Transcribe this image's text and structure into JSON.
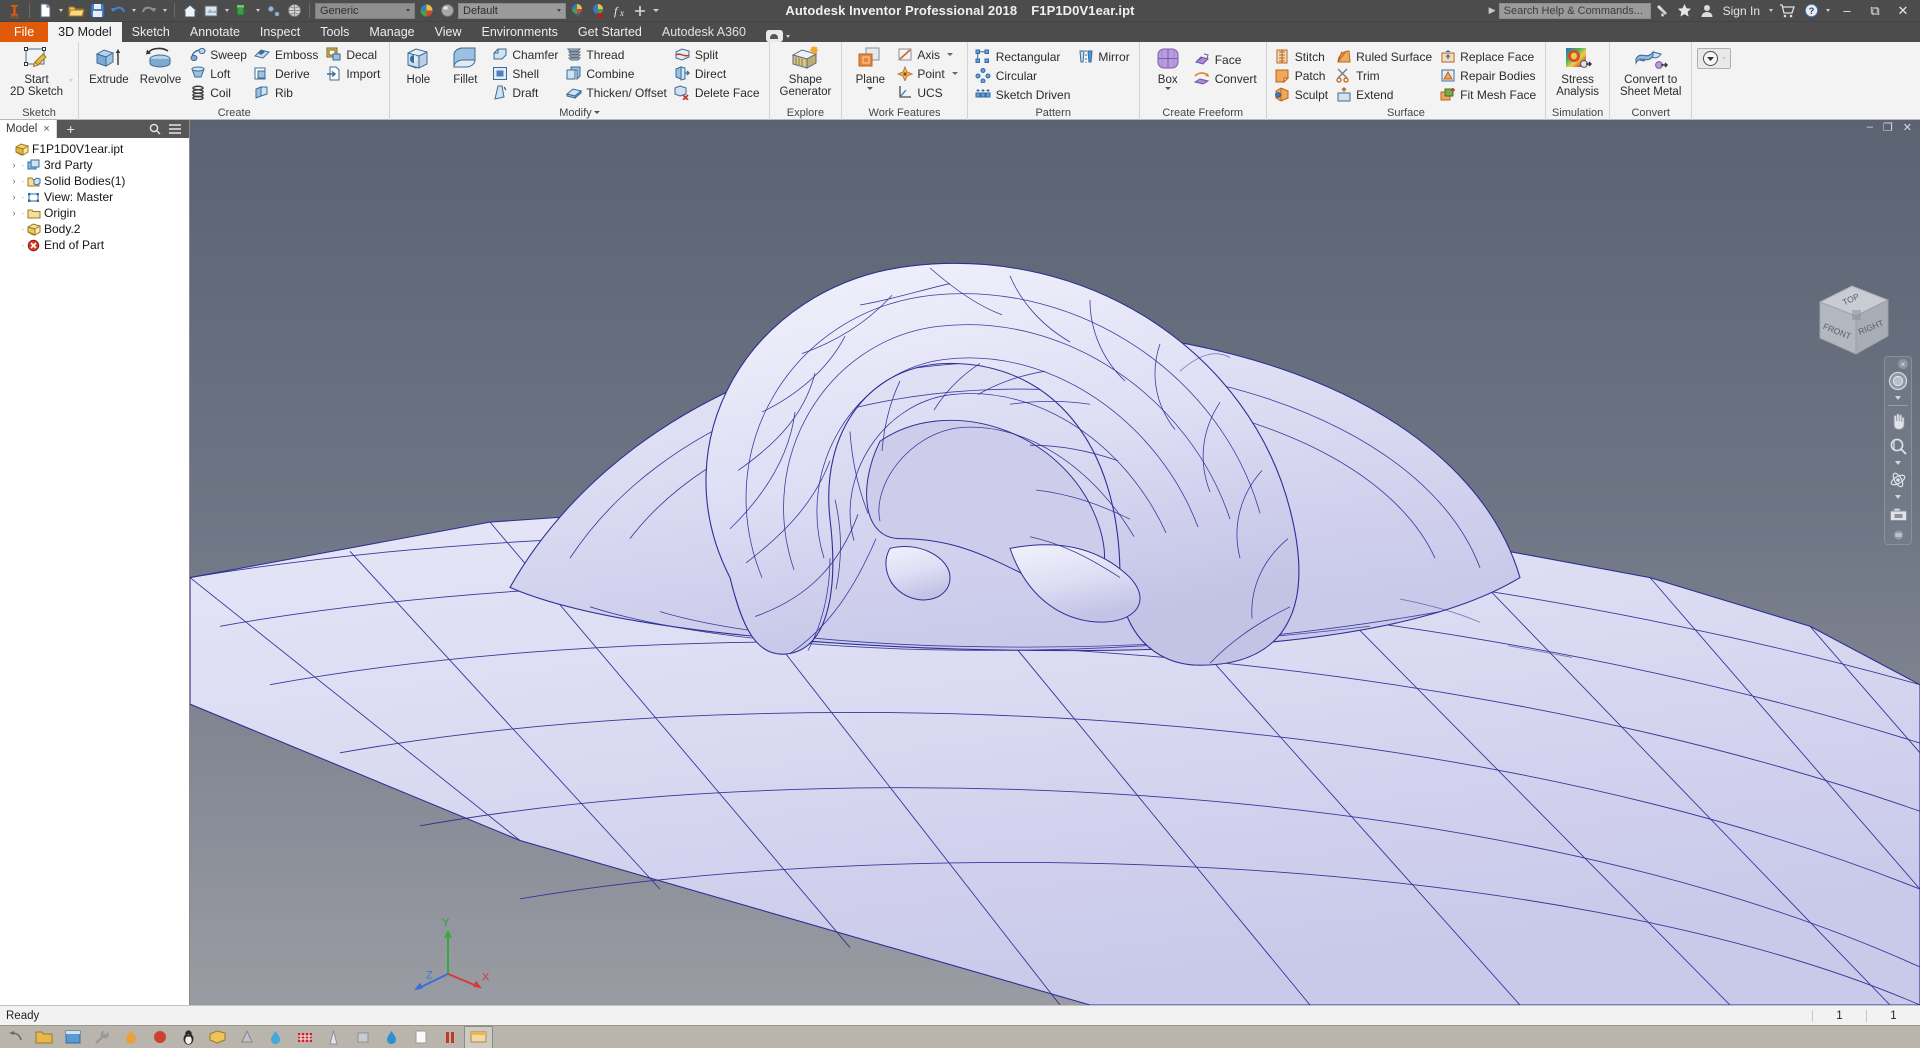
{
  "titlebar": {
    "app_title": "Autodesk Inventor Professional 2018",
    "file_name": "F1P1D0V1ear.ipt",
    "search_placeholder": "Search Help & Commands...",
    "sign_in": "Sign In",
    "material_selector": "Generic",
    "appearance_selector": "Default",
    "icons": {
      "new": "new-document-icon",
      "open": "open-folder-icon",
      "save": "save-icon",
      "undo": "undo-icon",
      "redo": "redo-icon",
      "home": "home-icon",
      "appearance": "appearance-icon",
      "material": "material-icon",
      "update": "update-icon",
      "select": "select-icon",
      "material_swatch": "color-wheel-icon",
      "appearance_swatch": "appearance-sphere-icon",
      "adjust": "color-adjust-icon",
      "clear": "clear-appearance-icon",
      "parameters": "fx-parameters-icon",
      "customize": "plus-icon",
      "qat_dropdown": "chevron-down-icon",
      "help_search": "search-toggle-icon",
      "satellite": "autodesk-satellite-icon",
      "favorites": "star-icon",
      "account": "user-icon",
      "cart": "shopping-cart-icon",
      "help": "help-icon",
      "minimize": "minimize-icon",
      "restore": "restore-icon",
      "close": "close-icon"
    }
  },
  "tabs": [
    {
      "label": "File",
      "state": "file"
    },
    {
      "label": "3D Model",
      "state": "active"
    },
    {
      "label": "Sketch",
      "state": "normal"
    },
    {
      "label": "Annotate",
      "state": "normal"
    },
    {
      "label": "Inspect",
      "state": "normal"
    },
    {
      "label": "Tools",
      "state": "normal"
    },
    {
      "label": "Manage",
      "state": "normal"
    },
    {
      "label": "View",
      "state": "normal"
    },
    {
      "label": "Environments",
      "state": "normal"
    },
    {
      "label": "Get Started",
      "state": "normal"
    },
    {
      "label": "Autodesk A360",
      "state": "normal"
    }
  ],
  "ribbon": {
    "panels": [
      {
        "name": "Sketch",
        "label": "Sketch",
        "has_dialog_launcher": false,
        "big": [
          {
            "label": "Start\n2D Sketch",
            "icon": "start-2d-sketch-icon",
            "dropdown": true
          }
        ],
        "groups": []
      },
      {
        "name": "Create",
        "label": "Create",
        "big": [
          {
            "label": "Extrude",
            "icon": "extrude-icon",
            "dropdown": false
          },
          {
            "label": "Revolve",
            "icon": "revolve-icon",
            "dropdown": false
          }
        ],
        "groups": [
          [
            {
              "label": "Sweep",
              "icon": "sweep-icon"
            },
            {
              "label": "Loft",
              "icon": "loft-icon"
            },
            {
              "label": "Coil",
              "icon": "coil-icon"
            }
          ],
          [
            {
              "label": "Emboss",
              "icon": "emboss-icon"
            },
            {
              "label": "Derive",
              "icon": "derive-icon"
            },
            {
              "label": "Rib",
              "icon": "rib-icon"
            }
          ],
          [
            {
              "label": "Decal",
              "icon": "decal-icon"
            },
            {
              "label": "Import",
              "icon": "import-icon"
            }
          ]
        ]
      },
      {
        "name": "Modify",
        "label": "Modify",
        "has_dialog_launcher": true,
        "big": [
          {
            "label": "Hole",
            "icon": "hole-icon",
            "dropdown": false
          },
          {
            "label": "Fillet",
            "icon": "fillet-icon",
            "dropdown": false
          }
        ],
        "groups": [
          [
            {
              "label": "Chamfer",
              "icon": "chamfer-icon"
            },
            {
              "label": "Shell",
              "icon": "shell-icon"
            },
            {
              "label": "Draft",
              "icon": "draft-icon"
            }
          ],
          [
            {
              "label": "Thread",
              "icon": "thread-icon"
            },
            {
              "label": "Combine",
              "icon": "combine-icon"
            },
            {
              "label": "Thicken/ Offset",
              "icon": "thicken-offset-icon"
            }
          ],
          [
            {
              "label": "Split",
              "icon": "split-icon"
            },
            {
              "label": "Direct",
              "icon": "direct-edit-icon"
            },
            {
              "label": "Delete Face",
              "icon": "delete-face-icon"
            }
          ]
        ]
      },
      {
        "name": "Explore",
        "label": "Explore",
        "big": [
          {
            "label": "Shape\nGenerator",
            "icon": "shape-generator-icon",
            "dropdown": false
          }
        ],
        "groups": []
      },
      {
        "name": "Work Features",
        "label": "Work Features",
        "big": [
          {
            "label": "Plane",
            "icon": "work-plane-icon",
            "dropdown": true
          }
        ],
        "groups": [
          [
            {
              "label": "Axis",
              "icon": "work-axis-icon",
              "dropdown": true
            },
            {
              "label": "Point",
              "icon": "work-point-icon",
              "dropdown": true
            },
            {
              "label": "UCS",
              "icon": "ucs-icon"
            }
          ]
        ]
      },
      {
        "name": "Pattern",
        "label": "Pattern",
        "big": [],
        "groups": [
          [
            {
              "label": "Rectangular",
              "icon": "rectangular-pattern-icon"
            },
            {
              "label": "Circular",
              "icon": "circular-pattern-icon"
            },
            {
              "label": "Sketch Driven",
              "icon": "sketch-driven-pattern-icon"
            }
          ],
          [
            {
              "label": "Mirror",
              "icon": "mirror-icon"
            }
          ]
        ]
      },
      {
        "name": "Create Freeform",
        "label": "Create Freeform",
        "big": [
          {
            "label": "Box",
            "icon": "freeform-box-icon",
            "dropdown": true
          }
        ],
        "groups": [
          [
            {
              "label": "Face",
              "icon": "freeform-face-icon"
            },
            {
              "label": "Convert",
              "icon": "freeform-convert-icon"
            }
          ]
        ]
      },
      {
        "name": "Surface",
        "label": "Surface",
        "big": [],
        "groups": [
          [
            {
              "label": "Stitch",
              "icon": "stitch-icon"
            },
            {
              "label": "Patch",
              "icon": "patch-icon"
            },
            {
              "label": "Sculpt",
              "icon": "sculpt-icon"
            }
          ],
          [
            {
              "label": "Ruled Surface",
              "icon": "ruled-surface-icon"
            },
            {
              "label": "Trim",
              "icon": "trim-icon"
            },
            {
              "label": "Extend",
              "icon": "extend-icon"
            }
          ],
          [
            {
              "label": "Replace Face",
              "icon": "replace-face-icon"
            },
            {
              "label": "Repair Bodies",
              "icon": "repair-bodies-icon"
            },
            {
              "label": "Fit Mesh Face",
              "icon": "fit-mesh-face-icon"
            }
          ]
        ]
      },
      {
        "name": "Simulation",
        "label": "Simulation",
        "big": [
          {
            "label": "Stress\nAnalysis",
            "icon": "stress-analysis-icon",
            "dropdown": false
          }
        ],
        "groups": []
      },
      {
        "name": "Convert",
        "label": "Convert",
        "big": [
          {
            "label": "Convert to\nSheet Metal",
            "icon": "convert-sheet-metal-icon",
            "dropdown": false
          }
        ],
        "groups": []
      },
      {
        "name": "Overflow",
        "label": "",
        "big": [],
        "groups": []
      }
    ]
  },
  "browser": {
    "tab_label": "Model",
    "close_label": "×",
    "add_label": "+",
    "search_icon": "search-icon",
    "menu_icon": "browser-menu-icon",
    "tree": [
      {
        "label": "F1P1D0V1ear.ipt",
        "icon": "part-document-icon",
        "indent": 0,
        "expander": ""
      },
      {
        "label": "3rd Party",
        "icon": "third-party-icon",
        "indent": 1,
        "expander": "›"
      },
      {
        "label": "Solid Bodies(1)",
        "icon": "solid-bodies-folder-icon",
        "indent": 1,
        "expander": "›"
      },
      {
        "label": "View: Master",
        "icon": "view-master-icon",
        "indent": 1,
        "expander": "›"
      },
      {
        "label": "Origin",
        "icon": "origin-folder-icon",
        "indent": 1,
        "expander": "›"
      },
      {
        "label": "Body.2",
        "icon": "solid-body-icon",
        "indent": 1,
        "expander": ""
      },
      {
        "label": "End of Part",
        "icon": "end-of-part-icon",
        "indent": 1,
        "expander": ""
      }
    ]
  },
  "viewport": {
    "window_buttons": {
      "minimize": "–",
      "restore": "❐",
      "close": "✕"
    },
    "view_cube": {
      "top": "TOP",
      "front": "FRONT",
      "right": "RIGHT"
    },
    "nav_bar": {
      "close": "×",
      "items": [
        "steering-wheel-icon",
        "pan-hand-icon",
        "zoom-magnifier-icon",
        "orbit-icon",
        "look-at-camera-icon",
        "navbar-options-icon"
      ]
    },
    "axis_triad": {
      "x": "X",
      "y": "Y",
      "z": "Z"
    },
    "colors": {
      "background_top": "#5b6373",
      "background_bottom": "#8d8f96",
      "model_fill": "#d8d8f2",
      "model_edge": "#2e2e96"
    }
  },
  "statusbar": {
    "message": "Ready",
    "cell1": "1",
    "cell2": "1"
  },
  "taskbar": {
    "items": [
      "back-arrow-icon",
      "folder-icon",
      "window-icon",
      "tool-icon",
      "flame-icon",
      "dot-red-icon",
      "penguin-icon",
      "box-app-icon",
      "cone-icon",
      "droplet-icon",
      "red-grid-icon",
      "tower-icon",
      "app-small-icon",
      "blue-droplet-icon",
      "white-page-icon",
      "pillars-icon",
      "inventor-icon"
    ]
  }
}
